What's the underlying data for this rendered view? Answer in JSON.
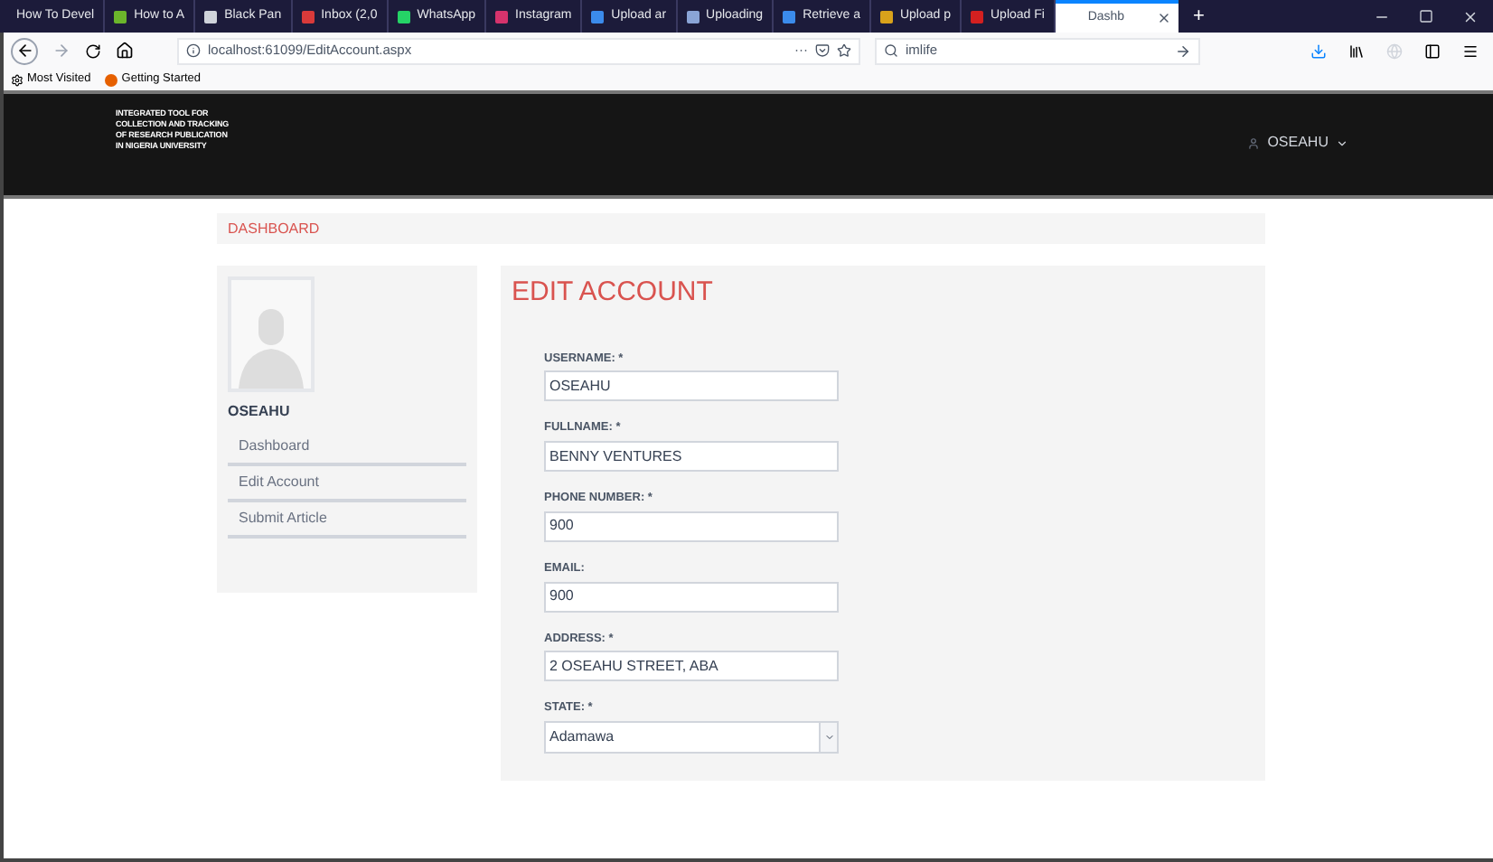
{
  "browser": {
    "tabs": [
      {
        "label": "How To Devel",
        "selected": false
      },
      {
        "label": "How to A",
        "selected": false,
        "color": "#6bb52b"
      },
      {
        "label": "Black Pan",
        "selected": false,
        "color": "#cfd3da"
      },
      {
        "label": "Inbox (2,0",
        "selected": false,
        "color": "#d93a3a"
      },
      {
        "label": "WhatsApp",
        "selected": false,
        "color": "#25d366"
      },
      {
        "label": "Instagram",
        "selected": false,
        "color": "#d6336c"
      },
      {
        "label": "Upload ar",
        "selected": false,
        "color": "#3b8beb"
      },
      {
        "label": "Uploading",
        "selected": false,
        "color": "#8aa4d6"
      },
      {
        "label": "Retrieve a",
        "selected": false,
        "color": "#3b8beb"
      },
      {
        "label": "Upload p",
        "selected": false,
        "color": "#d9a21b"
      },
      {
        "label": "Upload Fi",
        "selected": false,
        "color": "#d42020"
      },
      {
        "label": "Dashb",
        "selected": true
      }
    ],
    "new_tab": "+",
    "url": "localhost:61099/EditAccount.aspx",
    "url_dots": "···",
    "search_value": "imlife",
    "bookmarks": [
      "Most Visited",
      "Getting Started"
    ]
  },
  "site": {
    "logo_lines": [
      "INTEGRATED TOOL FOR",
      "COLLECTION AND TRACKING",
      "OF RESEARCH PUBLICATION",
      "IN NIGERIA UNIVERSITY"
    ],
    "user": "OSEAHU"
  },
  "breadcrumb": "DASHBOARD",
  "sidebar": {
    "name": "OSEAHU",
    "items": [
      "Dashboard",
      "Edit Account",
      "Submit Article"
    ]
  },
  "form": {
    "title": "EDIT ACCOUNT",
    "fields": [
      {
        "label": "USERNAME: *",
        "value": "OSEAHU",
        "kind": "text"
      },
      {
        "label": "FULLNAME: *",
        "value": "BENNY VENTURES",
        "kind": "text"
      },
      {
        "label": "PHONE NUMBER: *",
        "value": "900",
        "kind": "text"
      },
      {
        "label": "EMAIL:",
        "value": "900",
        "kind": "text"
      },
      {
        "label": "ADDRESS: *",
        "value": "2 OSEAHU STREET, ABA",
        "kind": "text"
      },
      {
        "label": "STATE: *",
        "value": "Adamawa",
        "kind": "select"
      }
    ]
  }
}
